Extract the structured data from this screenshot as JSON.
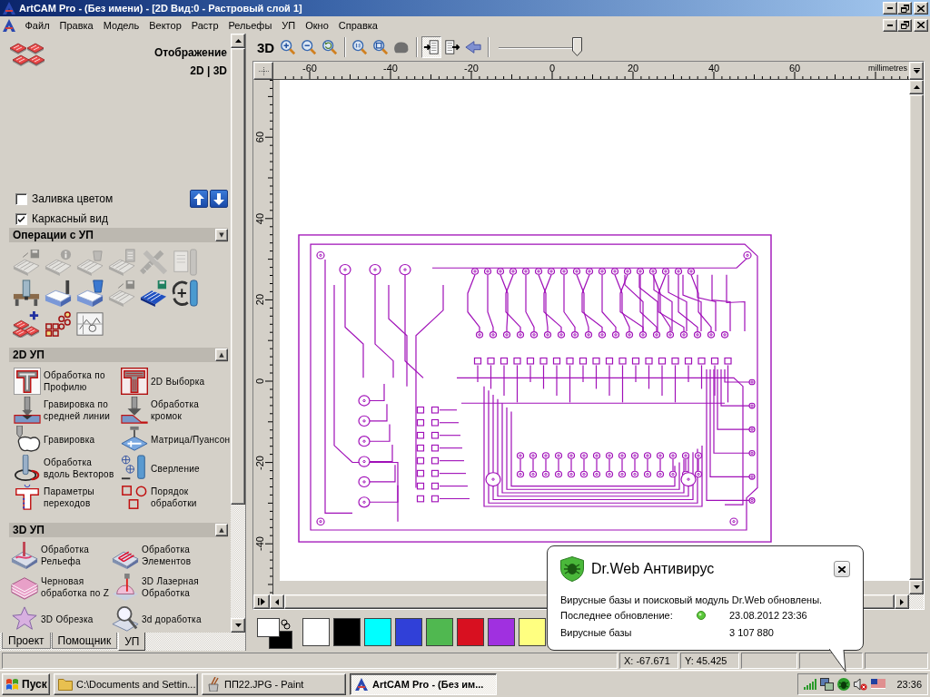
{
  "window": {
    "title": "ArtCAM Pro - (Без имени) - [2D Вид:0 - Растровый слой 1]"
  },
  "menu": {
    "items": [
      "Файл",
      "Правка",
      "Модель",
      "Вектор",
      "Растр",
      "Рельефы",
      "УП",
      "Окно",
      "Справка"
    ]
  },
  "panel": {
    "title": "Отображение",
    "view_switch": "2D | 3D",
    "options": [
      {
        "label": "Заливка цветом",
        "checked": false
      },
      {
        "label": "Каркасный вид",
        "checked": true
      }
    ],
    "operations": {
      "title": "Операции с УП",
      "toggle": "▼",
      "tools": [
        {
          "disabled": true
        },
        {
          "disabled": true
        },
        {
          "disabled": true
        },
        {
          "disabled": true
        },
        {
          "disabled": true
        },
        {
          "disabled": true
        },
        {
          "disabled": false
        },
        {
          "disabled": false
        },
        {
          "disabled": false
        },
        {
          "disabled": true
        },
        {
          "disabled": false
        },
        {
          "disabled": false
        },
        {
          "disabled": false
        },
        {
          "disabled": false
        },
        {
          "disabled": false
        }
      ]
    },
    "sections": [
      {
        "title": "2D УП",
        "toggle": "▲",
        "items": [
          {
            "label": "Обработка по\nПрофилю"
          },
          {
            "label": "2D Выборка"
          },
          {
            "label": "Гравировка по\nсредней линии"
          },
          {
            "label": "Обработка\nкромок"
          },
          {
            "label": "Гравировка"
          },
          {
            "label": "Матрица/Пуансон"
          },
          {
            "label": "Обработка\nвдоль Векторов"
          },
          {
            "label": "Сверление"
          },
          {
            "label": "Параметры\nпереходов"
          },
          {
            "label": "Порядок\nобработки"
          }
        ]
      },
      {
        "title": "3D УП",
        "toggle": "▲",
        "items": [
          {
            "label": "Обработка\nРельефа"
          },
          {
            "label": "Обработка\nЭлементов"
          },
          {
            "label": "Черновая\nобработка по Z"
          },
          {
            "label": "3D Лазерная\nОбработка"
          },
          {
            "label": "3D Обрезка"
          },
          {
            "label": "3d доработка"
          }
        ]
      }
    ],
    "tabs": [
      {
        "label": "Проект",
        "selected": false
      },
      {
        "label": "Помощник",
        "selected": false
      },
      {
        "label": "УП",
        "selected": true
      }
    ]
  },
  "toolbar": {
    "groups": [
      {
        "buttons": [
          {
            "label": "3D",
            "pressed": false
          },
          {
            "pressed": false
          },
          {
            "pressed": false
          },
          {
            "pressed": false
          }
        ]
      },
      {
        "buttons": [
          {
            "pressed": false
          },
          {
            "pressed": false
          },
          {
            "pressed": false
          }
        ]
      },
      {
        "buttons": [
          {
            "pressed": true
          },
          {
            "pressed": false
          },
          {
            "pressed": false
          }
        ]
      }
    ],
    "slider": {
      "level": 1
    }
  },
  "rulers": {
    "x_labels": [
      "-60",
      "-40",
      "-20",
      "0",
      "20",
      "40",
      "60"
    ],
    "unit": "millimetres",
    "y_labels": [
      "60",
      "40",
      "20",
      "0",
      "-20",
      "-40"
    ]
  },
  "palette": {
    "colors": [
      {
        "color": "#ffffff"
      },
      {
        "color": "#000000"
      },
      {
        "color": "#00ffff"
      },
      {
        "color": "#3040d8"
      },
      {
        "color": "#50b850"
      },
      {
        "color": "#d81020"
      },
      {
        "color": "#a030e0"
      },
      {
        "color": "#ffff80"
      }
    ]
  },
  "status_bar": {
    "cells": [
      "X: -67.671",
      "Y: 45.425"
    ]
  },
  "notification": {
    "title": "Dr.Web Антивирус",
    "message": "Вирусные базы и поисковый модуль Dr.Web обновлены.",
    "rows": [
      {
        "label": "Последнее обновление:",
        "value": "23.08.2012 23:36",
        "ok": true
      },
      {
        "label": "Вирусные базы",
        "value": "3 107 880"
      }
    ]
  },
  "taskbar": {
    "start": "Пуск",
    "tasks": [
      {
        "label": "C:\\Documents and Settin...",
        "selected": false
      },
      {
        "label": "ПП22.JPG - Paint",
        "selected": false
      },
      {
        "label": "ArtCAM Pro - (Без им...",
        "selected": true
      }
    ],
    "clock": "23:36"
  }
}
